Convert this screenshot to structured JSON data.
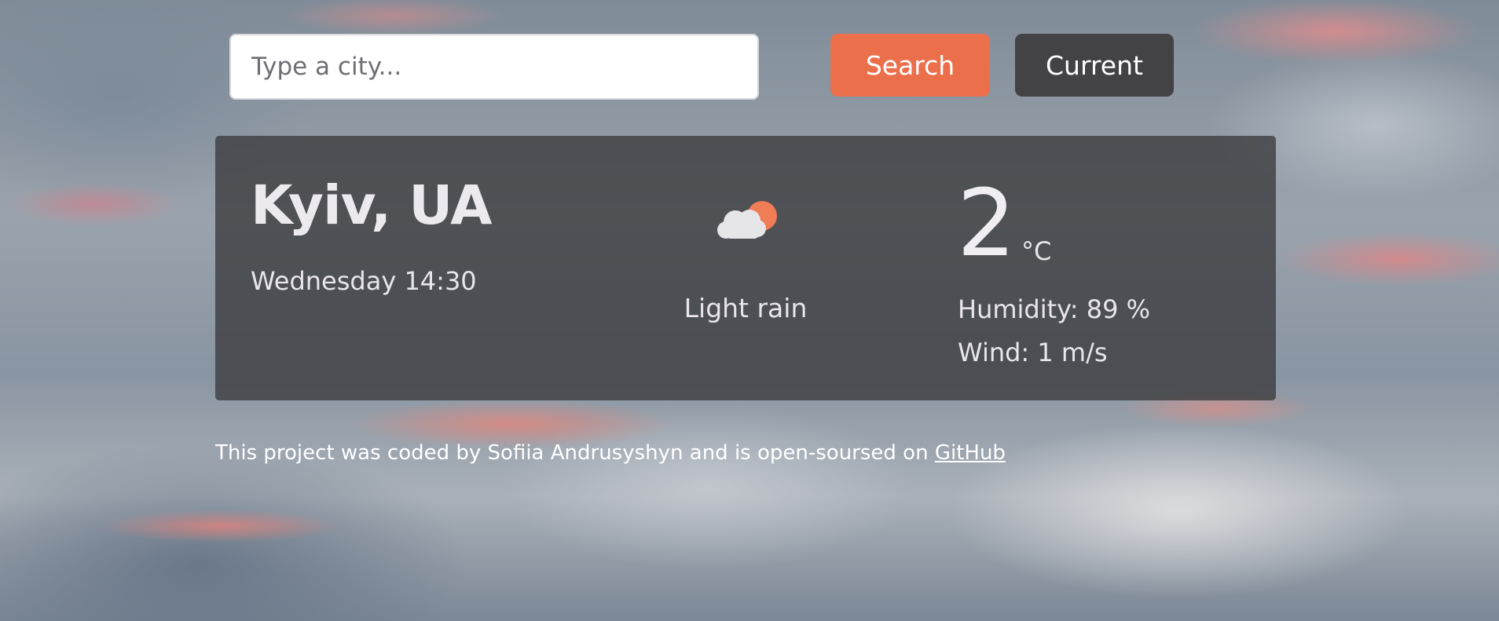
{
  "search": {
    "placeholder": "Type a city...",
    "value": "",
    "search_label": "Search",
    "current_label": "Current"
  },
  "weather": {
    "city": "Kyiv, UA",
    "datetime": "Wednesday 14:30",
    "description": "Light rain",
    "icon": "cloud-sun-icon",
    "temperature": "2",
    "unit": "°C",
    "humidity": "Humidity: 89 %",
    "wind": "Wind: 1 m/s"
  },
  "footer": {
    "text": "This project was coded by Sofiia Andrusyshyn and is open-soursed on ",
    "link_label": "GitHub"
  },
  "colors": {
    "search_button": "#ec6f4c",
    "current_button": "#434345",
    "card_background": "#3a3a3c"
  }
}
